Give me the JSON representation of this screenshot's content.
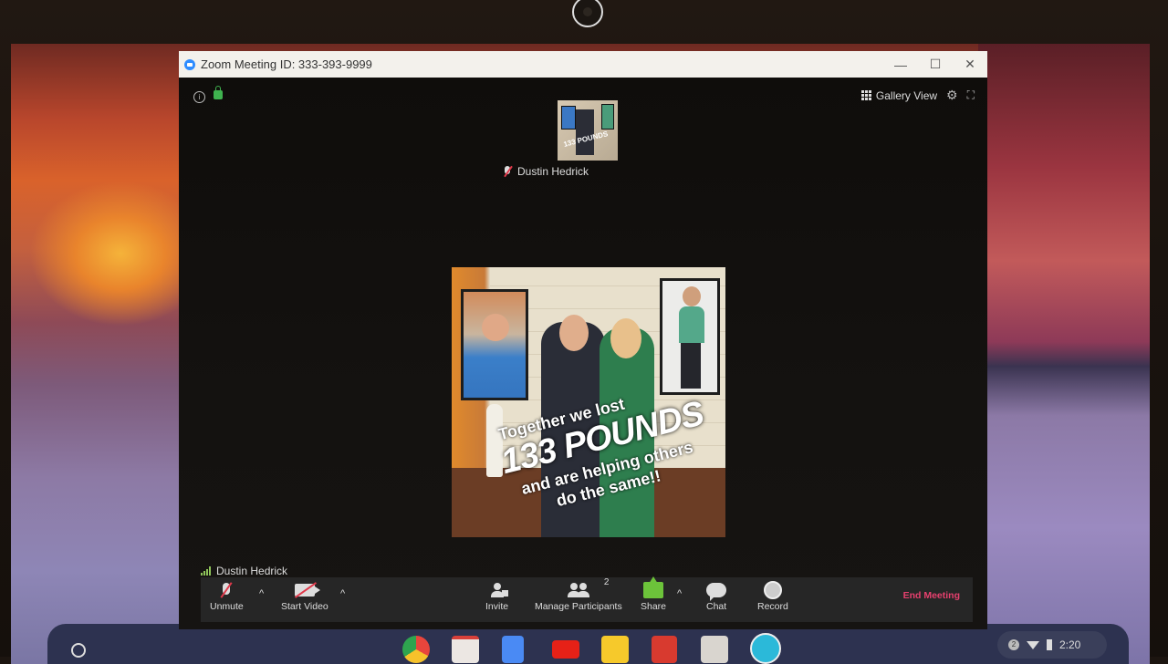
{
  "window": {
    "title": "Zoom Meeting ID: 333-393-9999",
    "controls": {
      "minimize": "—",
      "maximize": "☐",
      "close": "✕"
    }
  },
  "meeting": {
    "info_icon": "i",
    "view_mode_label": "Gallery View",
    "thumbnail": {
      "participant_name": "Dustin Hedrick",
      "muted": true,
      "preview_text": "133 POUNDS"
    },
    "shared_image": {
      "line1": "Together we lost",
      "line2": "133 POUNDS",
      "line3": "and are helping others",
      "line4": "do the same!!"
    },
    "self_name": "Dustin Hedrick"
  },
  "toolbar": {
    "unmute_label": "Unmute",
    "start_video_label": "Start Video",
    "invite_label": "Invite",
    "manage_participants_label": "Manage Participants",
    "participant_count": "2",
    "share_label": "Share",
    "chat_label": "Chat",
    "record_label": "Record",
    "end_meeting_label": "End Meeting",
    "caret": "^",
    "colors": {
      "end_meeting": "#e6406e",
      "share": "#6cc33a",
      "muted_slash": "#e0394b"
    }
  },
  "shelf": {
    "apps": [
      {
        "name": "Chrome",
        "color": "#e8453c"
      },
      {
        "name": "Gmail",
        "color": "#e9e4e1"
      },
      {
        "name": "Docs",
        "color": "#4a8af4"
      },
      {
        "name": "YouTube",
        "color": "#e62117"
      },
      {
        "name": "Keep",
        "color": "#f6c92b"
      },
      {
        "name": "Bookmark Manager",
        "color": "#d83a2f"
      },
      {
        "name": "Chrome Web Store",
        "color": "#e9e6e2"
      },
      {
        "name": "Zoom",
        "color": "#2bb9d9"
      }
    ],
    "status": {
      "notification_count": "2",
      "time": "2:20"
    }
  }
}
